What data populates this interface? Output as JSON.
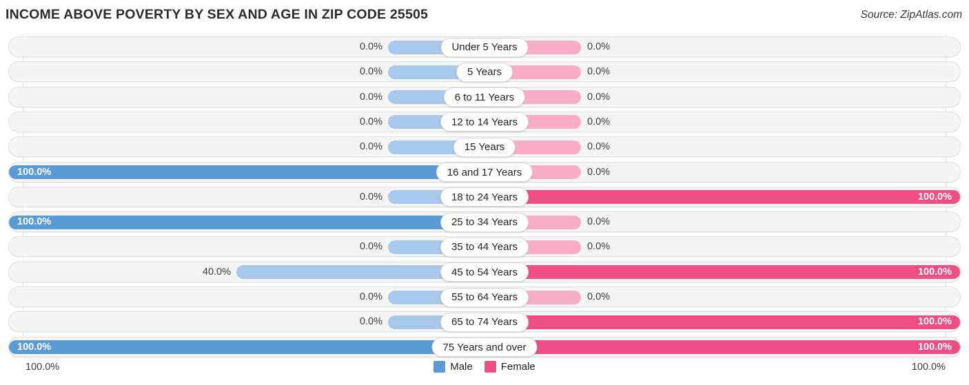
{
  "header": {
    "title": "INCOME ABOVE POVERTY BY SEX AND AGE IN ZIP CODE 25505",
    "source": "Source: ZipAtlas.com"
  },
  "legend": {
    "male_label": "Male",
    "female_label": "Female",
    "male_color": "#5b9bd5",
    "female_color": "#ef4d85"
  },
  "axis": {
    "left_label": "100.0%",
    "right_label": "100.0%"
  },
  "chart_data": {
    "type": "bar",
    "title": "INCOME ABOVE POVERTY BY SEX AND AGE IN ZIP CODE 25505",
    "subtitle": "Source: ZipAtlas.com",
    "orientation": "horizontal-diverging",
    "xlabel": "",
    "ylabel": "",
    "xlim": [
      0,
      100
    ],
    "unit": "%",
    "grid": true,
    "legend_position": "bottom-center",
    "categories": [
      "Under 5 Years",
      "5 Years",
      "6 to 11 Years",
      "12 to 14 Years",
      "15 Years",
      "16 and 17 Years",
      "18 to 24 Years",
      "25 to 34 Years",
      "35 to 44 Years",
      "45 to 54 Years",
      "55 to 64 Years",
      "65 to 74 Years",
      "75 Years and over"
    ],
    "series": [
      {
        "name": "Male",
        "color": "#5b9bd5",
        "values": [
          0.0,
          0.0,
          0.0,
          0.0,
          0.0,
          100.0,
          0.0,
          100.0,
          0.0,
          40.0,
          0.0,
          0.0,
          100.0
        ],
        "labels": [
          "0.0%",
          "0.0%",
          "0.0%",
          "0.0%",
          "0.0%",
          "100.0%",
          "0.0%",
          "100.0%",
          "0.0%",
          "40.0%",
          "0.0%",
          "0.0%",
          "100.0%"
        ]
      },
      {
        "name": "Female",
        "color": "#ef4d85",
        "values": [
          0.0,
          0.0,
          0.0,
          0.0,
          0.0,
          0.0,
          100.0,
          0.0,
          0.0,
          100.0,
          0.0,
          100.0,
          100.0
        ],
        "labels": [
          "0.0%",
          "0.0%",
          "0.0%",
          "0.0%",
          "0.0%",
          "0.0%",
          "100.0%",
          "0.0%",
          "0.0%",
          "100.0%",
          "0.0%",
          "100.0%",
          "100.0%"
        ]
      }
    ]
  }
}
